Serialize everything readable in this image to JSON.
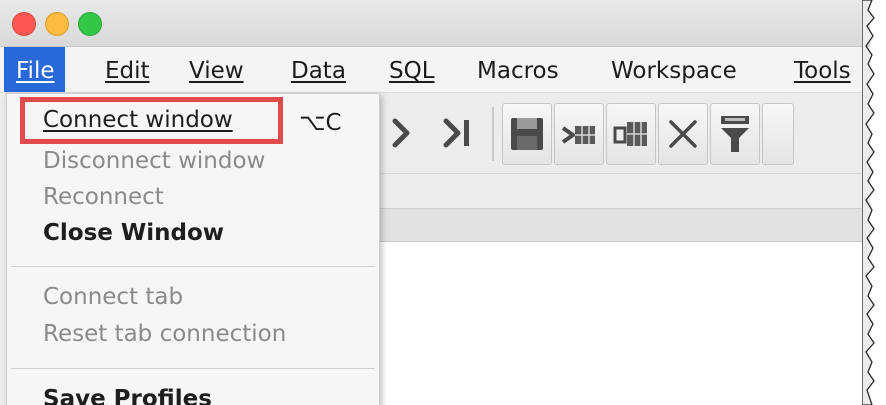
{
  "menu": {
    "file": "File",
    "edit": "Edit",
    "view": "View",
    "data": "Data",
    "sql": "SQL",
    "macros": "Macros",
    "workspace": "Workspace",
    "tools": "Tools"
  },
  "file_menu": {
    "items": [
      {
        "label": "Connect window",
        "shortcut": "⌥C",
        "enabled": true
      },
      {
        "label": "Disconnect window",
        "enabled": false
      },
      {
        "label": "Reconnect",
        "enabled": false
      },
      {
        "label": "Close Window",
        "enabled": true
      },
      {
        "label": "Connect tab",
        "enabled": false
      },
      {
        "label": "Reset tab connection",
        "enabled": false
      },
      {
        "label": "Save Profiles",
        "enabled": true
      }
    ]
  },
  "toolbar": {
    "icons": [
      "next-icon",
      "last-icon",
      "save-icon",
      "insert-row-icon",
      "copy-row-icon",
      "delete-icon",
      "filter-icon"
    ]
  },
  "colors": {
    "menu_highlight": "#2868d8",
    "annotation_box": "#e24b4b",
    "disabled_text": "#8a8a8a"
  }
}
